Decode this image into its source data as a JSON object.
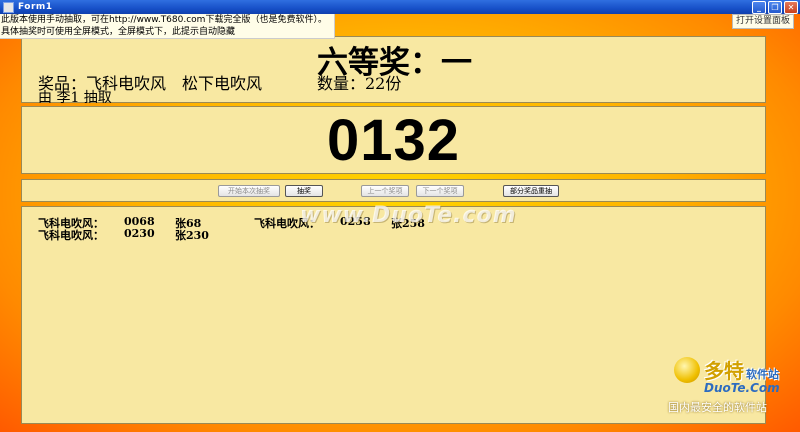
{
  "window": {
    "title": "Form1",
    "controls": {
      "minimize": "_",
      "restore": "❐",
      "close": "✕"
    }
  },
  "hint": {
    "line1": "此版本使用手动抽取，可在http://www.T680.com下载完全版（也是免费软件）。",
    "line2": "具体抽奖时可使用全屏模式，全屏模式下，此提示自动隐藏"
  },
  "settings_button": "打开设置面板",
  "prize": {
    "title": "六等奖：一",
    "items": "奖品：飞科电吹风　松下电吹风",
    "quantity": "数量：22份",
    "drawn_by": "由 李1 抽取"
  },
  "current_number": "0132",
  "buttons": {
    "start_round": "开始本次抽奖",
    "draw": "抽奖",
    "prev_prize": "上一个奖项",
    "next_prize": "下一个奖项",
    "redraw_partial": "部分奖品重抽"
  },
  "results": [
    {
      "prize": "飞科电吹风：",
      "number": "0068",
      "name": "张68"
    },
    {
      "prize": "飞科电吹风：",
      "number": "0258",
      "name": "张258"
    },
    {
      "prize": "飞科电吹风：",
      "number": "0230",
      "name": "张230"
    }
  ],
  "watermark": "www.DuoTe.com",
  "logo": {
    "brand": "多特",
    "brand_suffix": "软件站",
    "domain": "DuoTe.Com",
    "tagline": "国内最安全的软件站"
  },
  "colors": {
    "background_center": "#ffd400",
    "background_edge": "#ff5a00",
    "panel": "#f8e8a2",
    "titlebar": "#1750c8"
  }
}
